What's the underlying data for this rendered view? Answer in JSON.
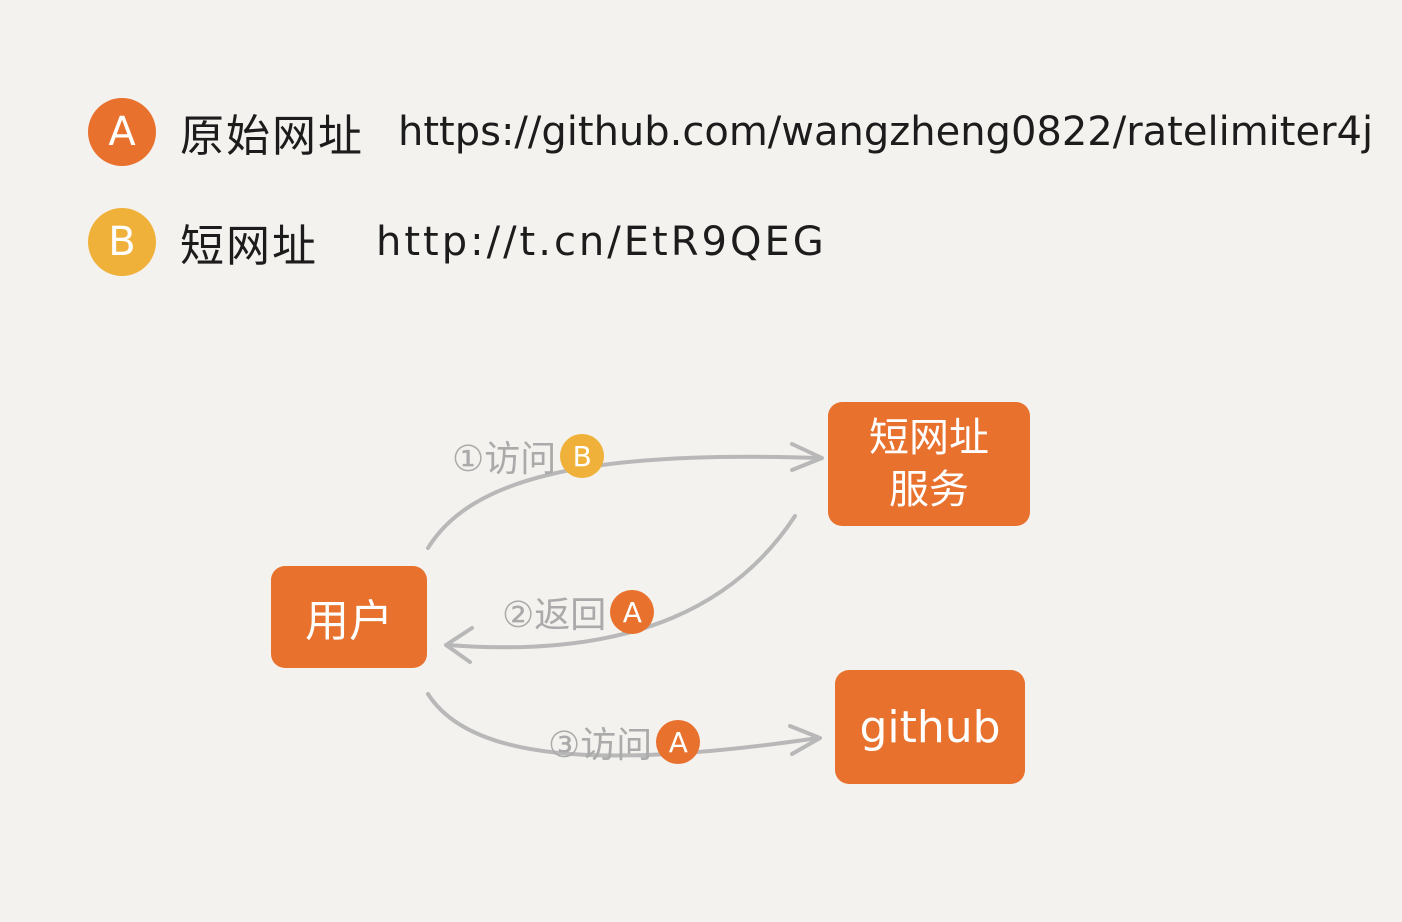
{
  "legend": {
    "a": {
      "badge": "A",
      "label": "原始网址",
      "url": "https://github.com/wangzheng0822/ratelimiter4j"
    },
    "b": {
      "badge": "B",
      "label": "短网址",
      "url": "http://t.cn/EtR9QEG"
    }
  },
  "nodes": {
    "user": "用户",
    "service_line1": "短网址",
    "service_line2": "服务",
    "github": "github"
  },
  "edges": {
    "step1": {
      "text": "①访问",
      "badge": "B"
    },
    "step2": {
      "text": "②返回",
      "badge": "A"
    },
    "step3": {
      "text": "③访问",
      "badge": "A"
    }
  },
  "colors": {
    "orange": "#e8712e",
    "yellow": "#f0b13a",
    "arrow": "#b8b8b8",
    "background": "#f4f2ee"
  }
}
